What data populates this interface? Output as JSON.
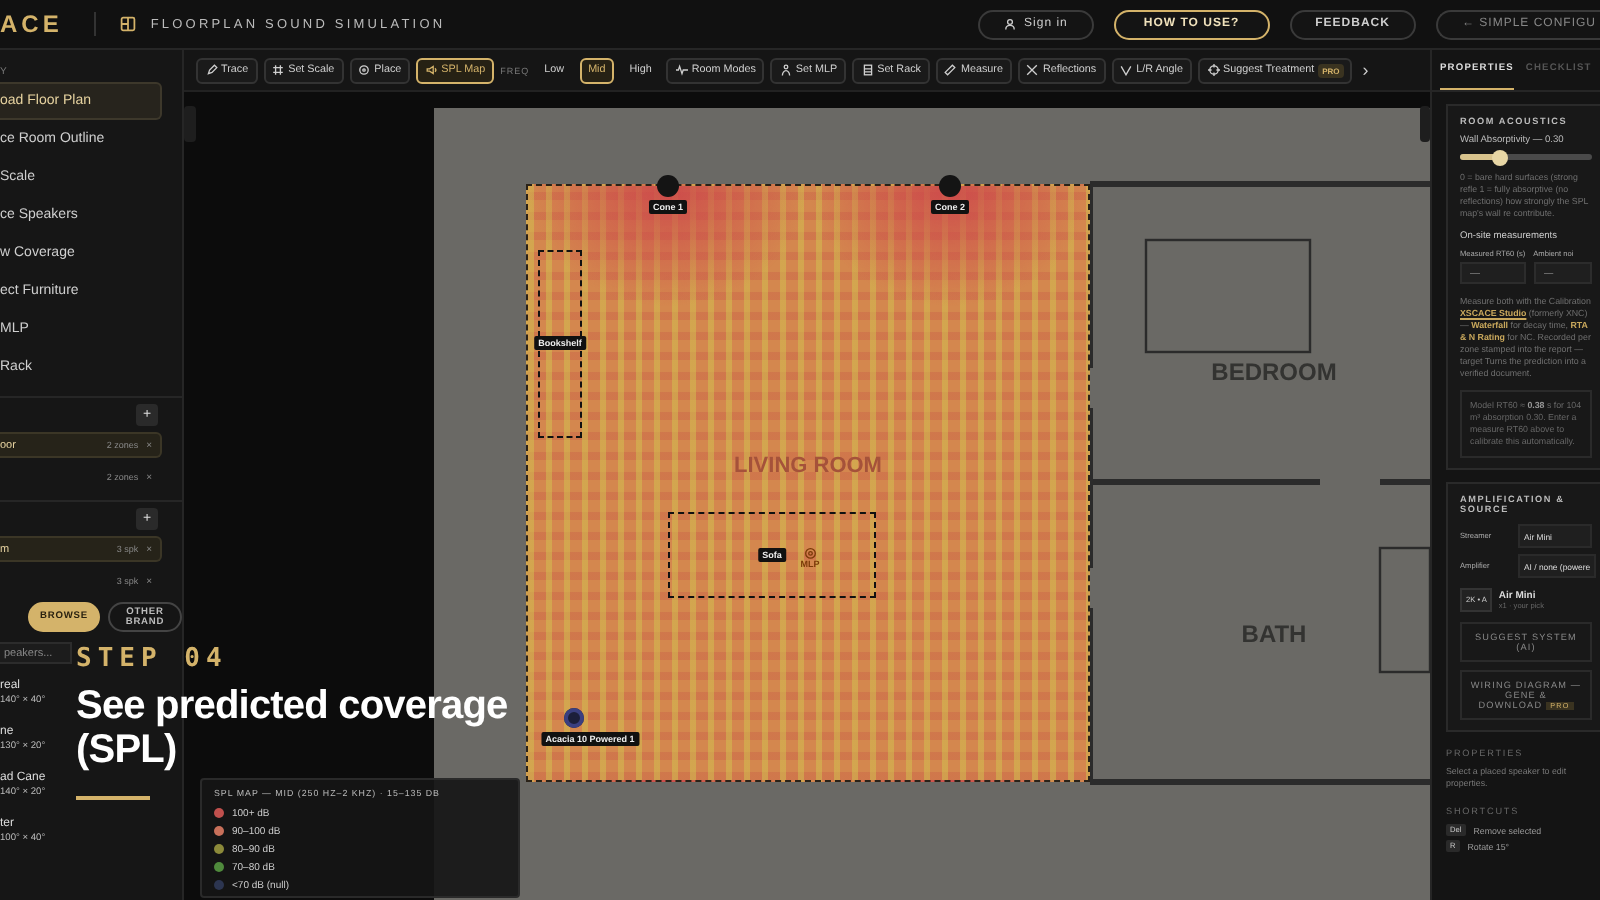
{
  "header": {
    "logo": "ACE",
    "title": "FLOORPLAN SOUND SIMULATION",
    "buttons": [
      {
        "label": "Sign in",
        "kind": "user"
      },
      {
        "label": "HOW TO USE?",
        "kind": "primary"
      },
      {
        "label": "FEEDBACK",
        "kind": "plain"
      },
      {
        "label": "← SIMPLE CONFIGU",
        "kind": "edge"
      }
    ]
  },
  "sidebar": {
    "heading": "Y",
    "steps": [
      {
        "label": "oad Floor Plan",
        "selected": true
      },
      {
        "label": "ce Room Outline",
        "selected": false
      },
      {
        "label": "Scale",
        "selected": false
      },
      {
        "label": "ce Speakers",
        "selected": false
      },
      {
        "label": "w Coverage",
        "selected": false
      },
      {
        "label": "ect Furniture",
        "selected": false
      },
      {
        "label": "MLP",
        "selected": false
      },
      {
        "label": "Rack",
        "selected": false
      }
    ],
    "groups": [
      {
        "add": "+",
        "rows": [
          {
            "name": "oor",
            "count": "2 zones",
            "remove": "×",
            "selected": true
          },
          {
            "count": "2 zones",
            "remove": "×",
            "selected": false
          }
        ]
      },
      {
        "add": "+",
        "rows": [
          {
            "name": "m",
            "count": "3 spk",
            "remove": "×",
            "selected": true
          },
          {
            "count": "3 spk",
            "remove": "×",
            "selected": false
          }
        ]
      }
    ],
    "source_tabs": [
      {
        "label": "BROWSE",
        "selected": true
      },
      {
        "label": "OTHER BRAND",
        "selected": false
      }
    ],
    "search": {
      "placeholder": "peakers..."
    },
    "speakers": [
      {
        "name": "real",
        "spec": "140° × 40°"
      },
      {
        "name": "ne",
        "spec": "130° × 20°"
      },
      {
        "name": "ad Cane",
        "spec": "140° × 20°"
      },
      {
        "name": "ter",
        "spec": "100° × 40°"
      }
    ]
  },
  "toolbar": {
    "items": [
      {
        "kind": "tool",
        "label": "Trace",
        "selected": false
      },
      {
        "kind": "tool",
        "label": "Set Scale",
        "selected": false
      },
      {
        "kind": "tool",
        "label": "Place",
        "selected": false
      },
      {
        "kind": "tool",
        "label": "SPL Map",
        "selected": true
      },
      {
        "kind": "caption",
        "label": "FREQ"
      },
      {
        "kind": "freq",
        "label": "Low",
        "selected": false
      },
      {
        "kind": "freq",
        "label": "Mid",
        "selected": true
      },
      {
        "kind": "freq",
        "label": "High",
        "selected": false
      },
      {
        "kind": "tool",
        "label": "Room Modes",
        "selected": false
      },
      {
        "kind": "tool",
        "label": "Set MLP",
        "selected": false
      },
      {
        "kind": "tool",
        "label": "Set Rack",
        "selected": false
      },
      {
        "kind": "tool",
        "label": "Measure",
        "selected": false
      },
      {
        "kind": "tool",
        "label": "Reflections",
        "selected": false
      },
      {
        "kind": "tool",
        "label": "L/R Angle",
        "selected": false
      },
      {
        "kind": "tool",
        "label": "Suggest Treatment",
        "badge": "PRO",
        "selected": false
      },
      {
        "kind": "more",
        "label": "›"
      }
    ]
  },
  "canvas": {
    "rooms": [
      {
        "label": "LIVING ROOM"
      },
      {
        "label": "BEDROOM"
      },
      {
        "label": "BATH"
      }
    ],
    "speakers": [
      {
        "label": "Cone 1",
        "kind": "cone"
      },
      {
        "label": "Cone 2",
        "kind": "cone"
      },
      {
        "label": "Acacia 10 Powered 1",
        "kind": "powered"
      }
    ],
    "furniture": [
      {
        "label": "Bookshelf"
      },
      {
        "label": "Sofa"
      }
    ],
    "mlp": "MLP",
    "legend": {
      "title": "SPL MAP — MID (250 HZ–2 KHZ) · 15–135 DB",
      "items": [
        {
          "label": "100+ dB",
          "color": "#c0504d"
        },
        {
          "label": "90–100 dB",
          "color": "#c8705a"
        },
        {
          "label": "80–90 dB",
          "color": "#8c8a3a"
        },
        {
          "label": "70–80 dB",
          "color": "#4f8a3c"
        },
        {
          "label": "<70 dB (null)",
          "color": "#2c3550"
        }
      ]
    }
  },
  "right_panel": {
    "tabs": [
      {
        "label": "PROPERTIES",
        "selected": true
      },
      {
        "label": "CHECKLIST",
        "selected": false
      }
    ],
    "room_acoustics": {
      "title": "ROOM ACOUSTICS",
      "slider": {
        "label": "Wall Absorptivity — 0.30",
        "level": 0.3
      },
      "help": "0 = bare hard surfaces (strong refle 1 = fully absorptive (no reflections) how strongly the SPL map's wall re contribute.",
      "measurements_title": "On-site measurements",
      "fields": [
        {
          "label": "Measured RT60 (s)",
          "placeholder": "—"
        },
        {
          "label": "Ambient noi",
          "placeholder": "—"
        }
      ],
      "info": "Measure both with the Calibration **XSCACE Studio** (formerly XNC) — **Waterfall** for decay time, **RTA & N Rating** for NC. Recorded per zone stamped into the report — target Turns the prediction into a verified document.",
      "note": "Model RT60 ≈ **0.38** s for 104 m³ absorption 0.30. Enter a measure RT60 above to calibrate this automatically."
    },
    "amplification": {
      "title": "AMPLIFICATION & SOURCE",
      "rows": [
        {
          "label": "Streamer",
          "value": "Air Mini"
        },
        {
          "label": "Amplifier",
          "value": "AI / none (powere"
        }
      ],
      "speaker": {
        "badge": "2K • A",
        "name": "Air Mini",
        "sub": "x1 · your pick"
      },
      "buttons": [
        {
          "label": "SUGGEST SYSTEM (AI)"
        },
        {
          "label": "WIRING DIAGRAM — GENE & DOWNLOAD",
          "badge": "PRO"
        }
      ]
    },
    "properties": {
      "title": "PROPERTIES",
      "text": "Select a placed speaker to edit properties."
    },
    "shortcuts": {
      "title": "SHORTCUTS",
      "items": [
        {
          "key": "Del",
          "label": "Remove selected"
        },
        {
          "key": "R",
          "label": "Rotate 15°"
        }
      ]
    }
  },
  "overlay": {
    "step": "STEP 04",
    "title": "See predicted coverage (SPL)"
  }
}
